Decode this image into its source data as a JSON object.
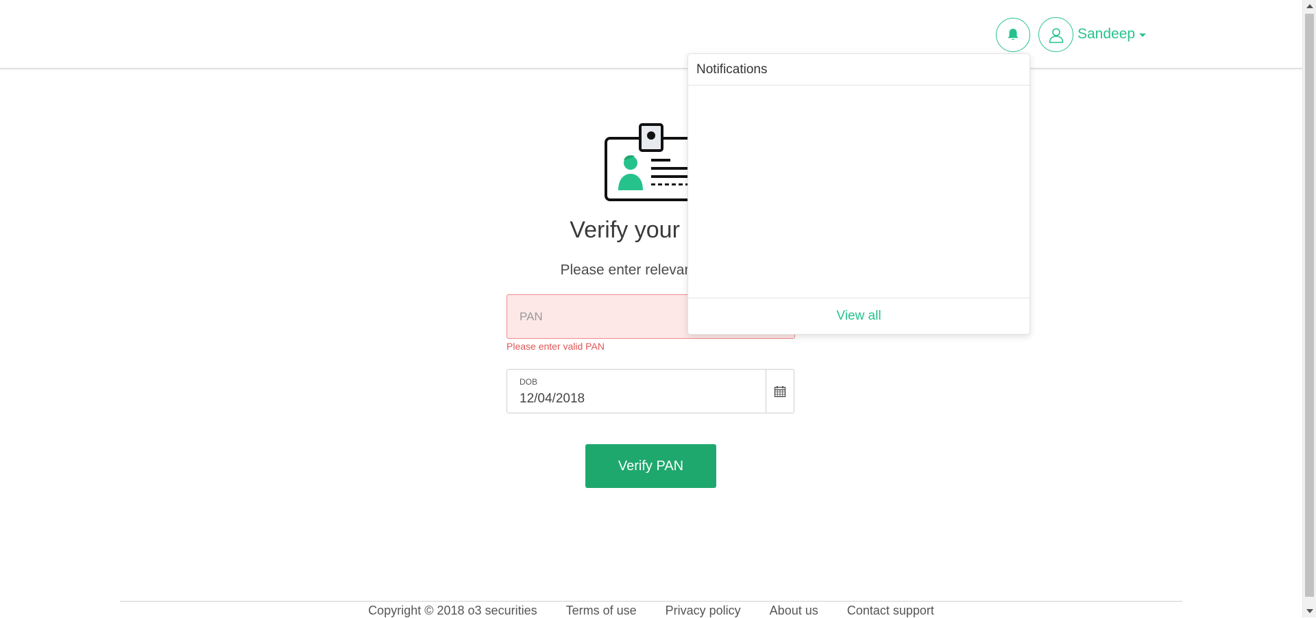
{
  "header": {
    "user_name": "Sandeep",
    "bell_icon": "bell-icon",
    "avatar_icon": "user-icon"
  },
  "main": {
    "title": "Verify your PAN",
    "subtitle": "Please enter relevant details",
    "pan": {
      "placeholder": "PAN",
      "value": "",
      "error": "Please enter valid PAN"
    },
    "dob": {
      "label": "DOB",
      "value": "12/04/2018",
      "icon": "calendar-icon"
    },
    "verify_button": "Verify PAN"
  },
  "notifications": {
    "title": "Notifications",
    "items": [],
    "view_all": "View all"
  },
  "footer": {
    "copyright": "Copyright © 2018 o3 securities",
    "terms": "Terms of use",
    "privacy": "Privacy policy",
    "about": "About us",
    "contact": "Contact support"
  },
  "colors": {
    "accent": "#26c28c",
    "button": "#1fa86e",
    "error": "#e25555",
    "error_bg": "#fde7e7"
  }
}
